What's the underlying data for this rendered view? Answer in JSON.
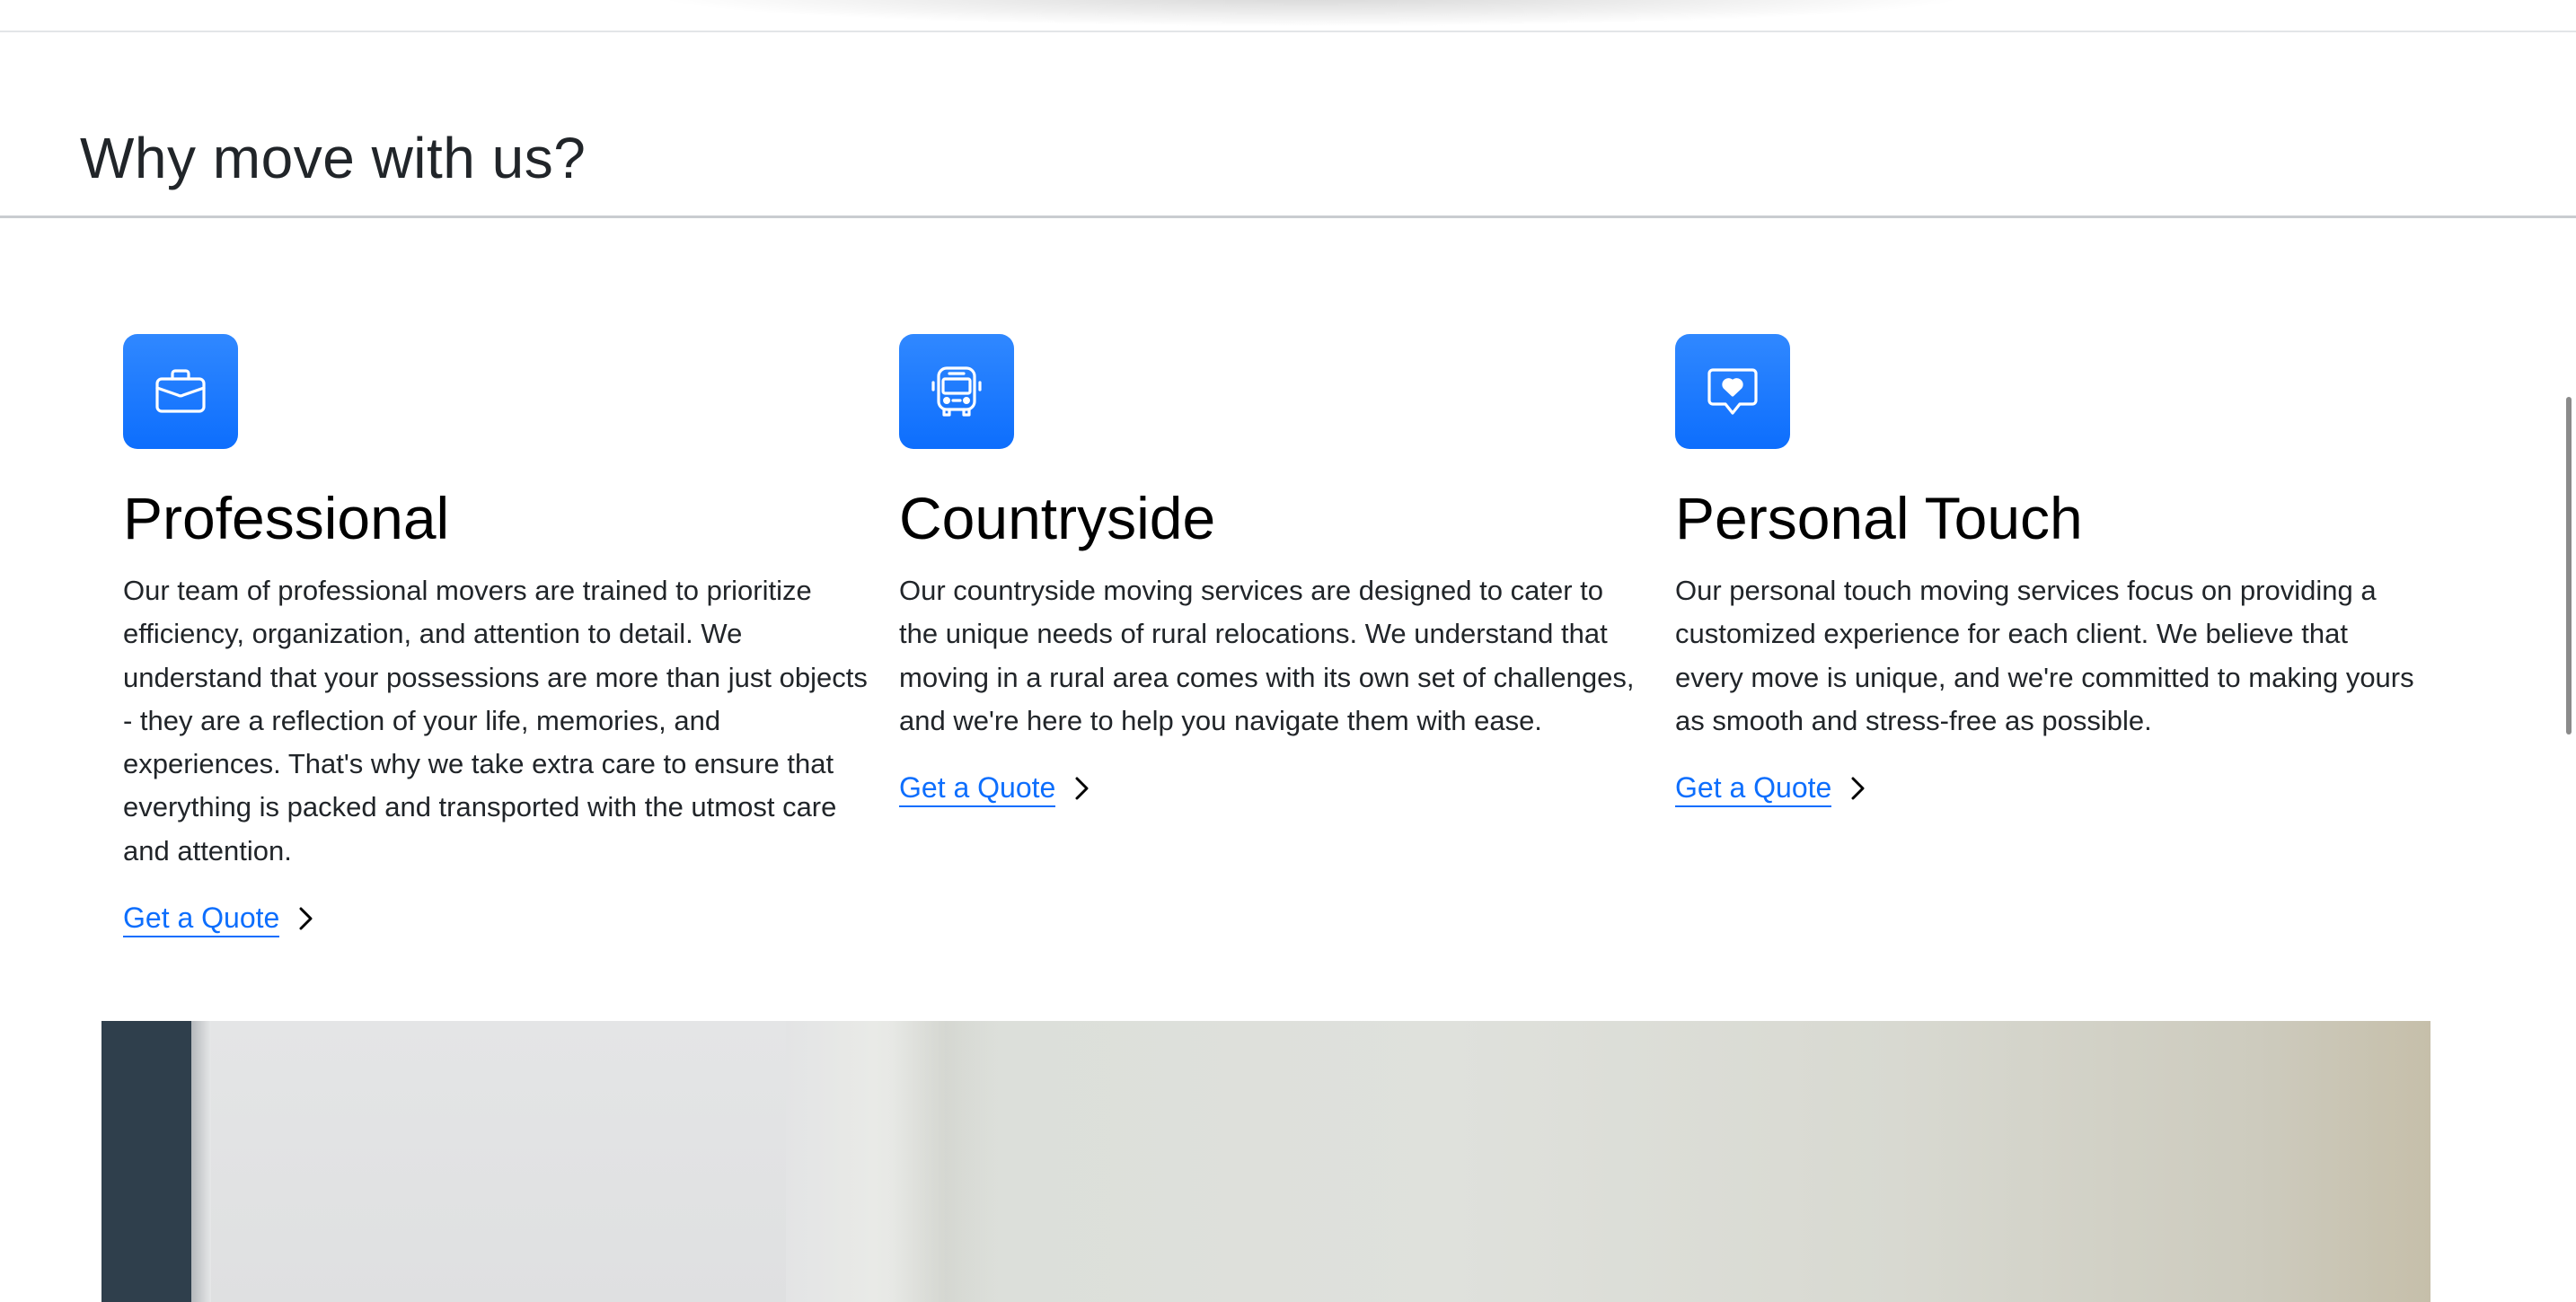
{
  "section": {
    "title": "Why move with us?"
  },
  "features": [
    {
      "icon": "briefcase-icon",
      "title": "Professional",
      "text": "Our team of professional movers are trained to prioritize efficiency, organization, and attention to detail. We understand that your possessions are more than just objects - they are a reflection of your life, memories, and experiences. That's why we take extra care to ensure that everything is packed and transported with the utmost care and attention.",
      "link_label": "Get a Quote"
    },
    {
      "icon": "bus-icon",
      "title": "Countryside",
      "text": "Our countryside moving services are designed to cater to the unique needs of rural relocations. We understand that moving in a rural area comes with its own set of challenges, and we're here to help you navigate them with ease.",
      "link_label": "Get a Quote"
    },
    {
      "icon": "chat-heart-icon",
      "title": "Personal Touch",
      "text": "Our personal touch moving services focus on providing a customized experience for each client. We believe that every move is unique, and we're committed to making yours as smooth and stress-free as possible.",
      "link_label": "Get a Quote"
    }
  ],
  "colors": {
    "accent": "#0d6efd",
    "heading": "#212529"
  }
}
